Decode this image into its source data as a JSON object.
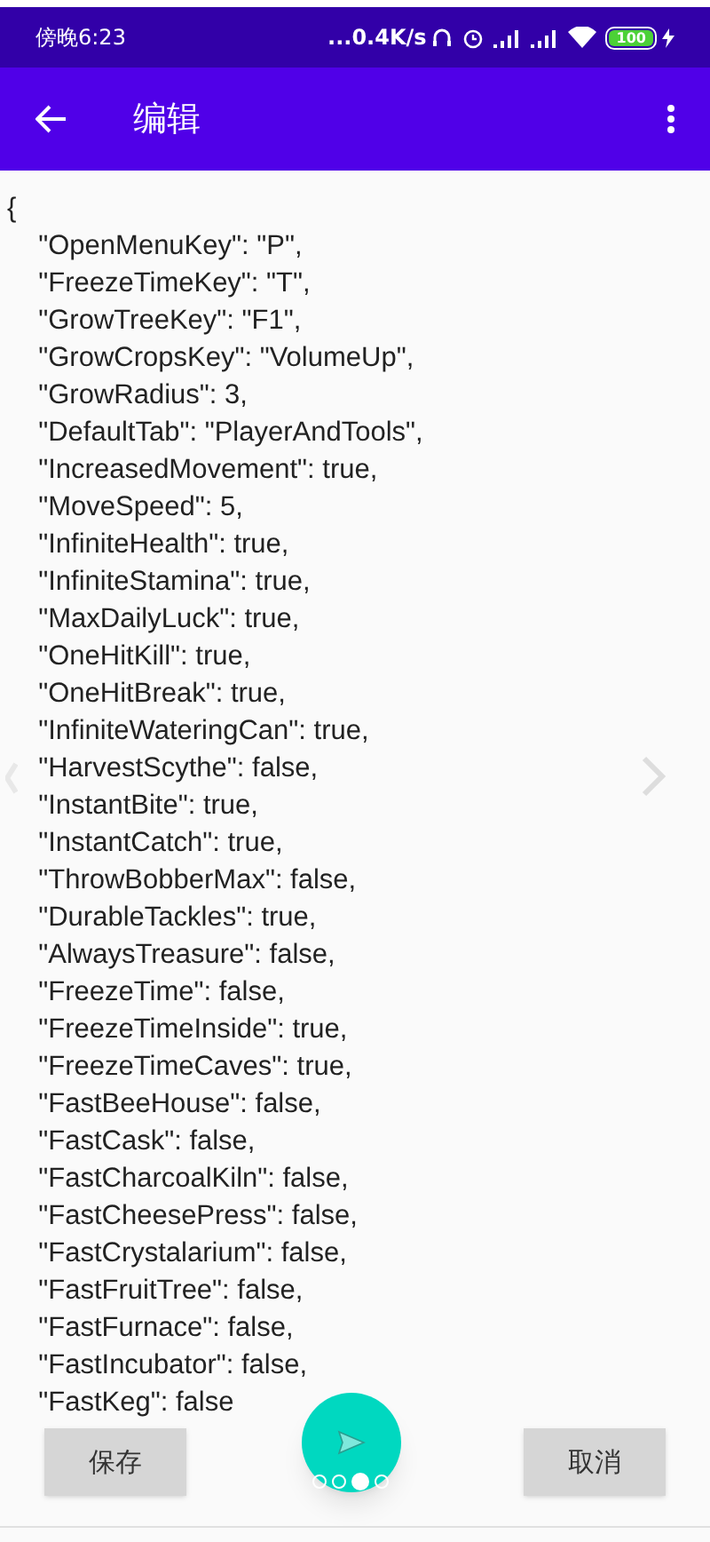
{
  "status_bar": {
    "time": "傍晚6:23",
    "speed": "...0.4K/s",
    "battery": "100"
  },
  "app_bar": {
    "title": "编辑"
  },
  "editor": {
    "open": "{",
    "entries": [
      "  \"OpenMenuKey\": \"P\",",
      "  \"FreezeTimeKey\": \"T\",",
      "  \"GrowTreeKey\": \"F1\",",
      "  \"GrowCropsKey\": \"VolumeUp\",",
      "  \"GrowRadius\": 3,",
      "  \"DefaultTab\": \"PlayerAndTools\",",
      "  \"IncreasedMovement\": true,",
      "  \"MoveSpeed\": 5,",
      "  \"InfiniteHealth\": true,",
      "  \"InfiniteStamina\": true,",
      "  \"MaxDailyLuck\": true,",
      "  \"OneHitKill\": true,",
      "  \"OneHitBreak\": true,",
      "  \"InfiniteWateringCan\": true,",
      "  \"HarvestScythe\": false,",
      "  \"InstantBite\": true,",
      "  \"InstantCatch\": true,",
      "  \"ThrowBobberMax\": false,",
      "  \"DurableTackles\": true,",
      "  \"AlwaysTreasure\": false,",
      "  \"FreezeTime\": false,",
      "  \"FreezeTimeInside\": true,",
      "  \"FreezeTimeCaves\": true,",
      "  \"FastBeeHouse\": false,",
      "  \"FastCask\": false,",
      "  \"FastCharcoalKiln\": false,",
      "  \"FastCheesePress\": false,",
      "  \"FastCrystalarium\": false,",
      "  \"FastFruitTree\": false,",
      "  \"FastFurnace\": false,",
      "  \"FastIncubator\": false,",
      "  \"FastKeg\": false"
    ]
  },
  "buttons": {
    "save": "保存",
    "cancel": "取消"
  },
  "pager": [
    {
      "selected": false
    },
    {
      "selected": false
    },
    {
      "selected": true
    },
    {
      "selected": false
    }
  ]
}
